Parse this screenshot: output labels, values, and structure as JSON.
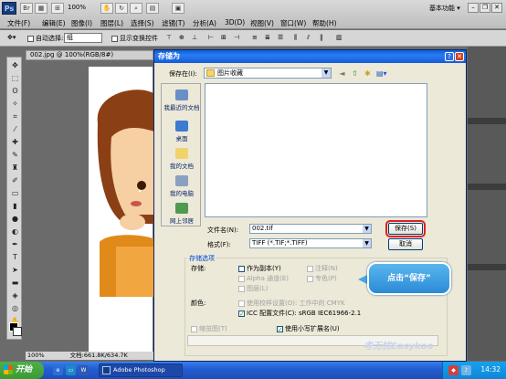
{
  "app": {
    "logo": "Ps",
    "zoom": "100%",
    "workspace": "基本功能 ▾",
    "menus": [
      "文件(F)",
      "编辑(E)",
      "图像(I)",
      "图层(L)",
      "选择(S)",
      "滤镜(T)",
      "分析(A)",
      "3D(D)",
      "视图(V)",
      "窗口(W)",
      "帮助(H)"
    ]
  },
  "options_bar": {
    "auto_select_label": "自动选择:",
    "auto_select_value": "组",
    "show_transform_label": "显示变换控件"
  },
  "document": {
    "tab_title": "002.jpg @ 100%(RGB/8#)",
    "status_zoom": "100%",
    "status_doc": "文档:661.8K/634.7K"
  },
  "dialog": {
    "title": "存储为",
    "save_in_label": "保存在(I):",
    "save_in_value": "图片收藏",
    "places": [
      "我最近的文档",
      "桌面",
      "我的文档",
      "我的电脑",
      "网上邻居"
    ],
    "filename_label": "文件名(N):",
    "filename_value": "002.tif",
    "format_label": "格式(F):",
    "format_value": "TIFF (*.TIF;*.TIFF)",
    "save_button": "保存(S)",
    "cancel_button": "取消",
    "options_title": "存储选项",
    "storage_label": "存储:",
    "as_copy": "作为副本(Y)",
    "alpha": "Alpha 通道(E)",
    "layers": "图层(L)",
    "notes": "注释(N)",
    "spot": "专色(P)",
    "color_label": "颜色:",
    "use_proof": "使用校样设置(O): 工作中的 CMYK",
    "icc": "ICC 配置文件(C): sRGB IEC61966-2.1",
    "thumbnail": "缩览图(T)",
    "lowercase_ext": "使用小写扩展名(U)"
  },
  "annotation": {
    "text": "点击“保存”"
  },
  "watermark": "考无忧Easykao",
  "taskbar": {
    "start": "开始",
    "task": "Adobe Photoshop",
    "clock": "14:32"
  }
}
